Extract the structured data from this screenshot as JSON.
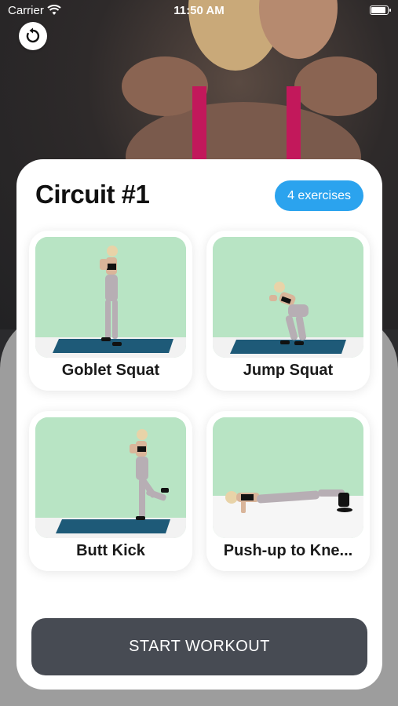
{
  "status_bar": {
    "carrier": "Carrier",
    "time": "11:50 AM"
  },
  "circuit": {
    "title": "Circuit #1",
    "exercise_count": "4 exercises"
  },
  "exercises": [
    {
      "label": "Goblet Squat"
    },
    {
      "label": "Jump Squat"
    },
    {
      "label": "Butt Kick"
    },
    {
      "label": "Push-up to Kne..."
    }
  ],
  "actions": {
    "start_label": "START WORKOUT"
  },
  "colors": {
    "badge": "#2ba3ee",
    "start_button": "#474b53",
    "tile_wall": "#b8e4c4",
    "mat": "#1e5a78"
  },
  "icons": {
    "back": "restart-arrow-icon",
    "wifi": "wifi-icon",
    "battery": "battery-icon"
  }
}
